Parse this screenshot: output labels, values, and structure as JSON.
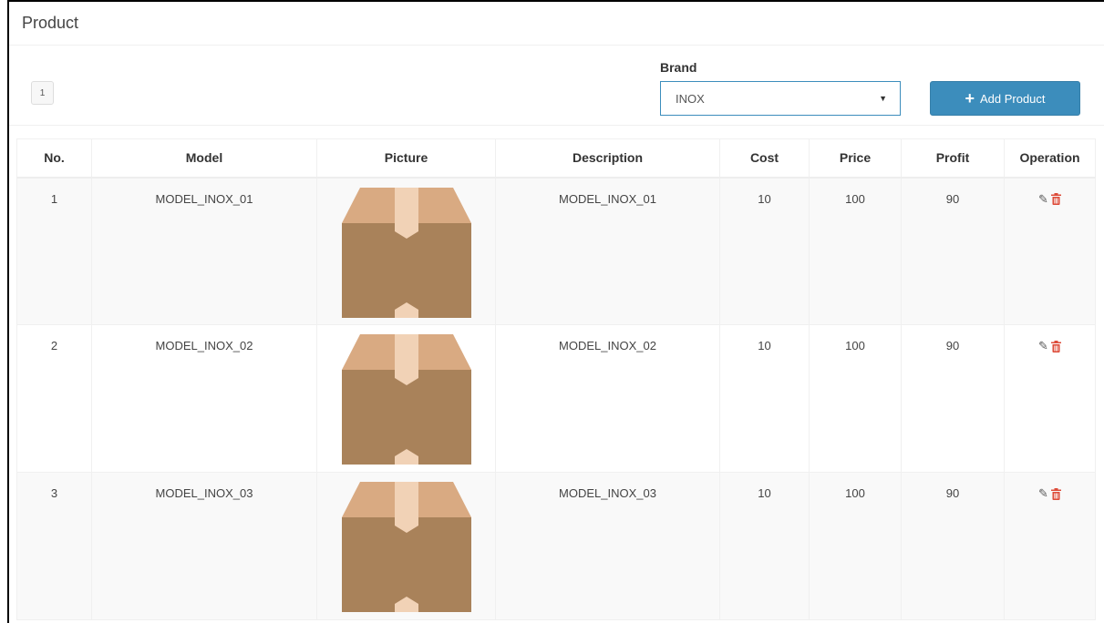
{
  "panel": {
    "title": "Product"
  },
  "pagination": {
    "current_page": "1"
  },
  "brand": {
    "label": "Brand",
    "selected": "INOX"
  },
  "toolbar": {
    "add_label": "Add Product"
  },
  "table": {
    "columns": [
      "No.",
      "Model",
      "Picture",
      "Description",
      "Cost",
      "Price",
      "Profit",
      "Operation"
    ],
    "rows": [
      {
        "no": "1",
        "model": "MODEL_INOX_01",
        "description": "MODEL_INOX_01",
        "cost": "10",
        "price": "100",
        "profit": "90"
      },
      {
        "no": "2",
        "model": "MODEL_INOX_02",
        "description": "MODEL_INOX_02",
        "cost": "10",
        "price": "100",
        "profit": "90"
      },
      {
        "no": "3",
        "model": "MODEL_INOX_03",
        "description": "MODEL_INOX_03",
        "cost": "10",
        "price": "100",
        "profit": "90"
      }
    ]
  },
  "icons": {
    "edit": "edit-icon",
    "delete": "trash-icon",
    "picture": "cardboard-box-icon",
    "add": "plus-icon",
    "dropdown": "caret-down-icon"
  },
  "colors": {
    "primary": "#3c8dbc",
    "danger": "#dd4b39",
    "box_light": "#d9aa82",
    "box_dark": "#a9825a"
  }
}
